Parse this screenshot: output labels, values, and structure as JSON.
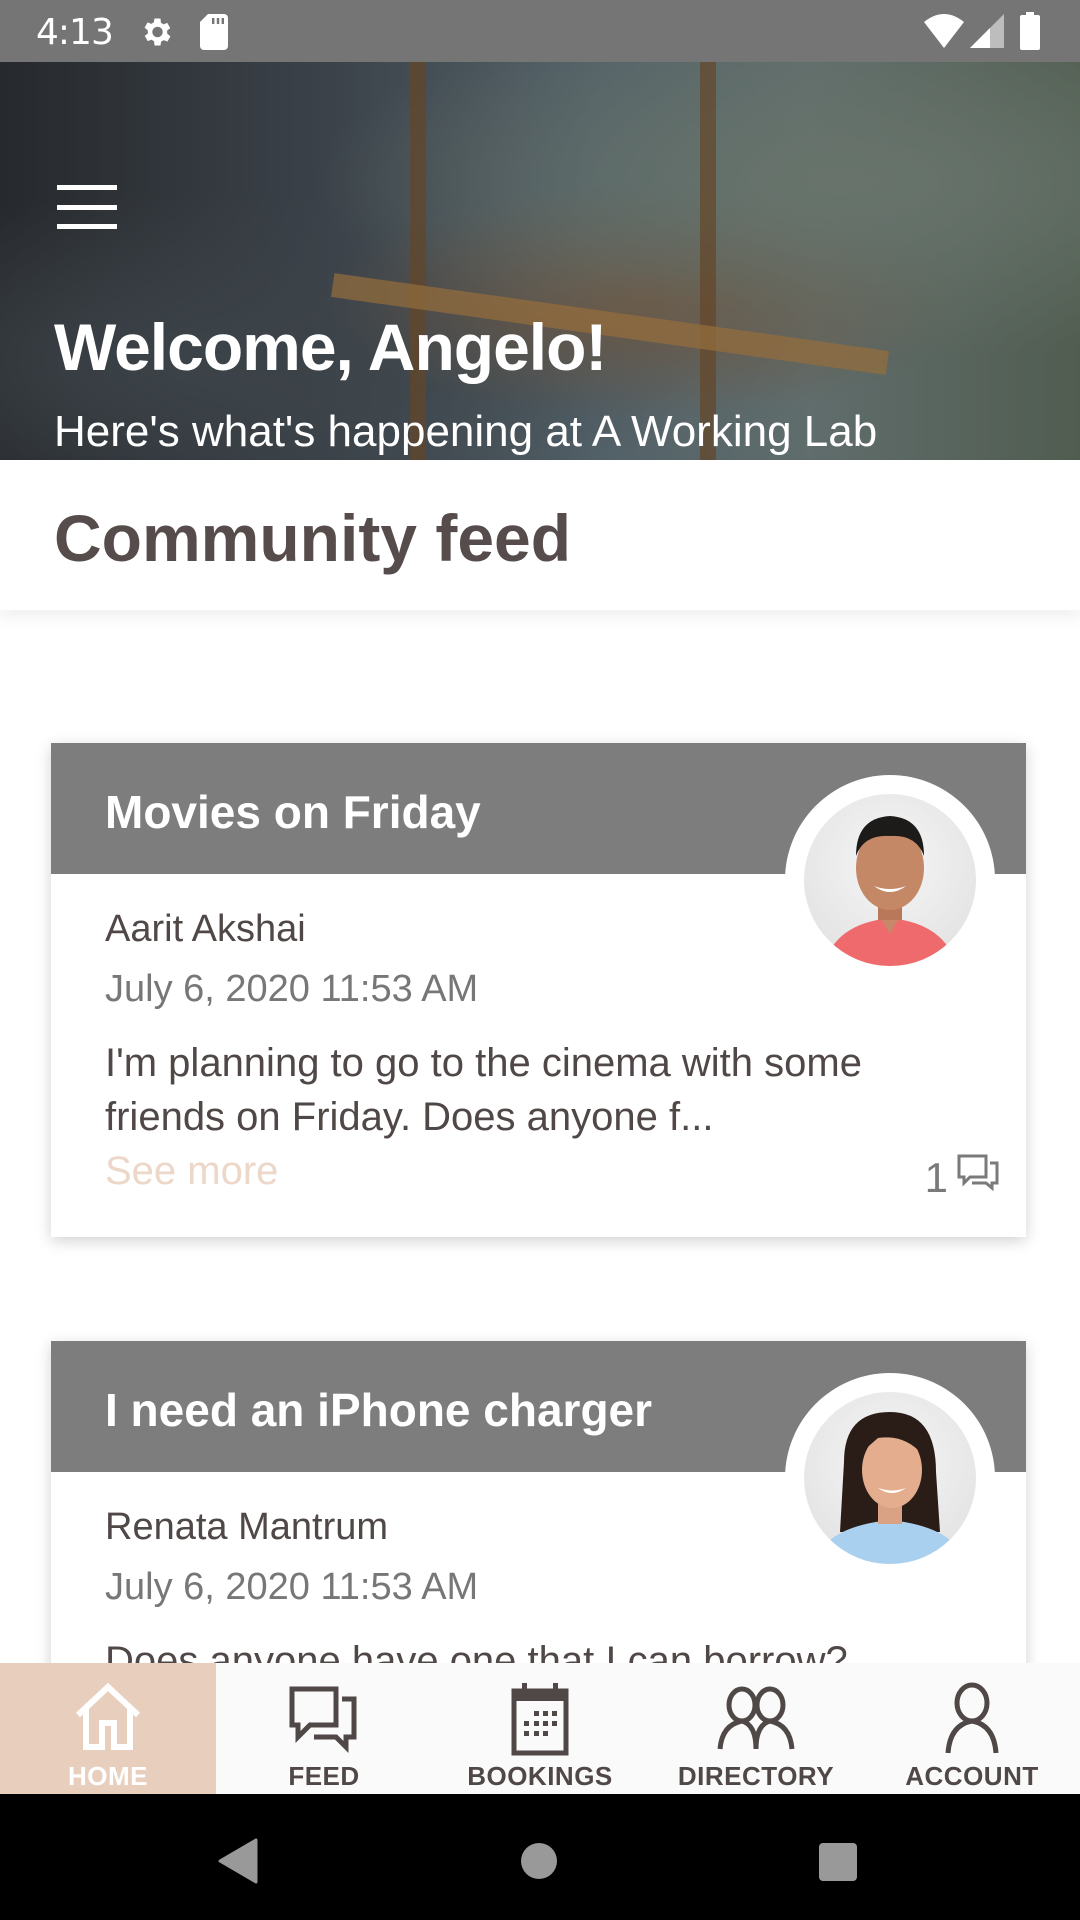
{
  "status_bar": {
    "time": "4:13",
    "icons": [
      "settings-gear-icon",
      "sd-card-icon",
      "wifi-icon",
      "cell-signal-icon",
      "battery-icon"
    ]
  },
  "hero": {
    "title": "Welcome, Angelo!",
    "subtitle": "Here's what's happening at A Working Lab",
    "menu_icon": "hamburger-menu-icon"
  },
  "section": {
    "title": "Community feed"
  },
  "posts": [
    {
      "title": "Movies on Friday",
      "author": "Aarit Akshai",
      "date": "July 6, 2020 11:53 AM",
      "excerpt": "I'm planning to go to the cinema with some friends on Friday. Does anyone f...",
      "see_more": "See more",
      "comment_count": "1"
    },
    {
      "title": "I need an iPhone charger",
      "author": "Renata Mantrum",
      "date": "July 6, 2020 11:53 AM",
      "excerpt": "Does anyone have one that I can borrow?"
    }
  ],
  "bottom_nav": {
    "active": "HOME",
    "items": [
      {
        "label": "HOME",
        "icon": "home-icon"
      },
      {
        "label": "FEED",
        "icon": "chat-bubbles-icon"
      },
      {
        "label": "BOOKINGS",
        "icon": "calendar-icon"
      },
      {
        "label": "DIRECTORY",
        "icon": "people-icon"
      },
      {
        "label": "ACCOUNT",
        "icon": "person-icon"
      }
    ]
  },
  "colors": {
    "accent": "#e8cfbd",
    "see_more": "#ecd7c8",
    "card_header": "#7d7d7d",
    "text_dark": "#504847"
  }
}
